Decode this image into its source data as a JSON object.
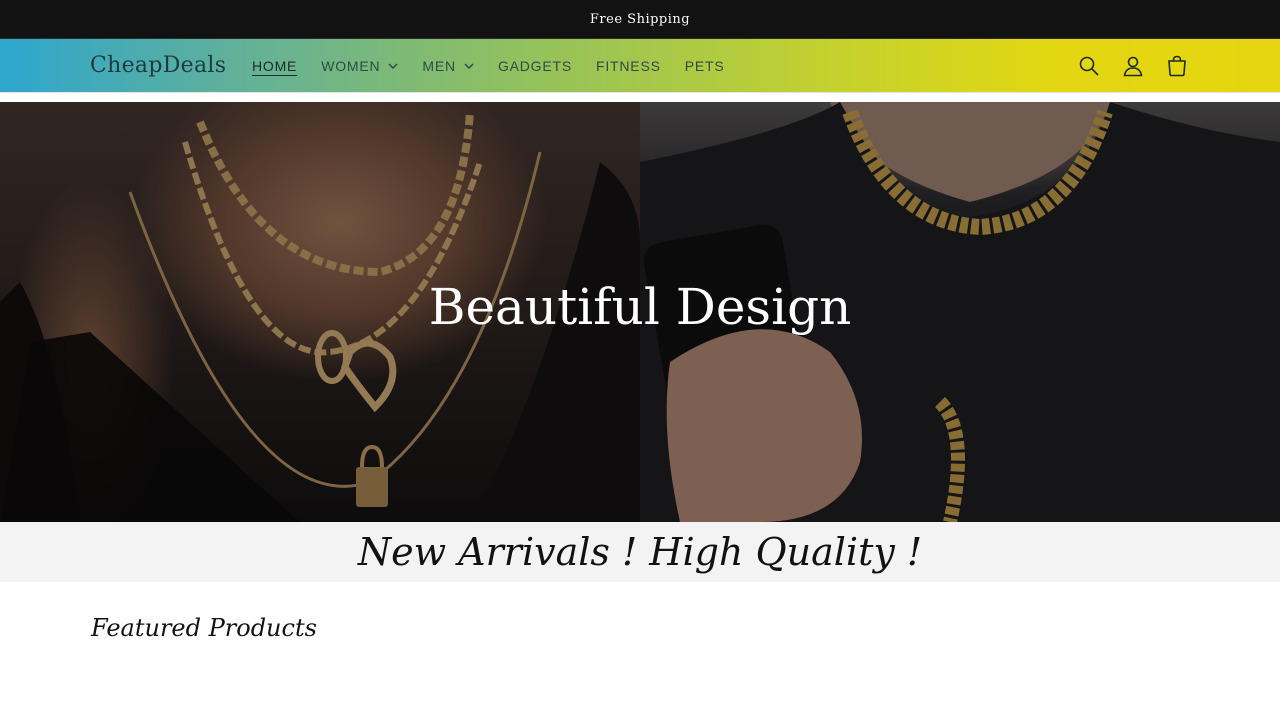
{
  "announcement": {
    "text": "Free Shipping"
  },
  "header": {
    "logo": "CheapDeals",
    "nav": [
      {
        "label": "HOME",
        "active": true,
        "has_dropdown": false
      },
      {
        "label": "WOMEN",
        "active": false,
        "has_dropdown": true
      },
      {
        "label": "MEN",
        "active": false,
        "has_dropdown": true
      },
      {
        "label": "GADGETS",
        "active": false,
        "has_dropdown": false
      },
      {
        "label": "FITNESS",
        "active": false,
        "has_dropdown": false
      },
      {
        "label": "PETS",
        "active": false,
        "has_dropdown": false
      }
    ],
    "icons": [
      "search-icon",
      "account-icon",
      "cart-icon"
    ]
  },
  "hero": {
    "title": "Beautiful Design"
  },
  "banner": {
    "text": "New Arrivals ! High Quality !"
  },
  "featured": {
    "heading": "Featured Products"
  },
  "colors": {
    "announcement_bg": "#121212",
    "gradient_start": "#2da6cf",
    "gradient_end": "#e6d510",
    "banner_bg": "#f3f3f3"
  }
}
